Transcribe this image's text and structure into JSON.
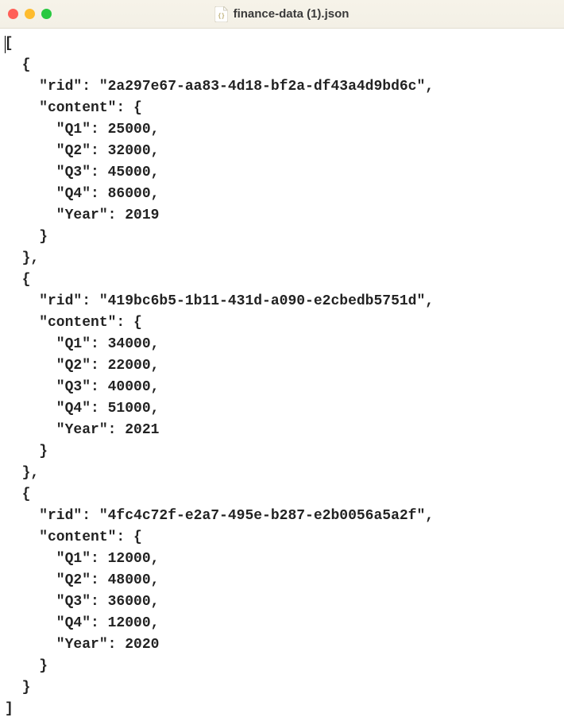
{
  "window": {
    "title": "finance-data (1).json"
  },
  "cursor": {
    "visible": true
  },
  "records": [
    {
      "rid": "2a297e67-aa83-4d18-bf2a-df43a4d9bd6c",
      "content": {
        "Q1": 25000,
        "Q2": 32000,
        "Q3": 45000,
        "Q4": 86000,
        "Year": 2019
      }
    },
    {
      "rid": "419bc6b5-1b11-431d-a090-e2cbedb5751d",
      "content": {
        "Q1": 34000,
        "Q2": 22000,
        "Q3": 40000,
        "Q4": 51000,
        "Year": 2021
      }
    },
    {
      "rid": "4fc4c72f-e2a7-495e-b287-e2b0056a5a2f",
      "content": {
        "Q1": 12000,
        "Q2": 48000,
        "Q3": 36000,
        "Q4": 12000,
        "Year": 2020
      }
    }
  ],
  "labels": {
    "rid": "rid",
    "content": "content",
    "Q1": "Q1",
    "Q2": "Q2",
    "Q3": "Q3",
    "Q4": "Q4",
    "Year": "Year"
  }
}
